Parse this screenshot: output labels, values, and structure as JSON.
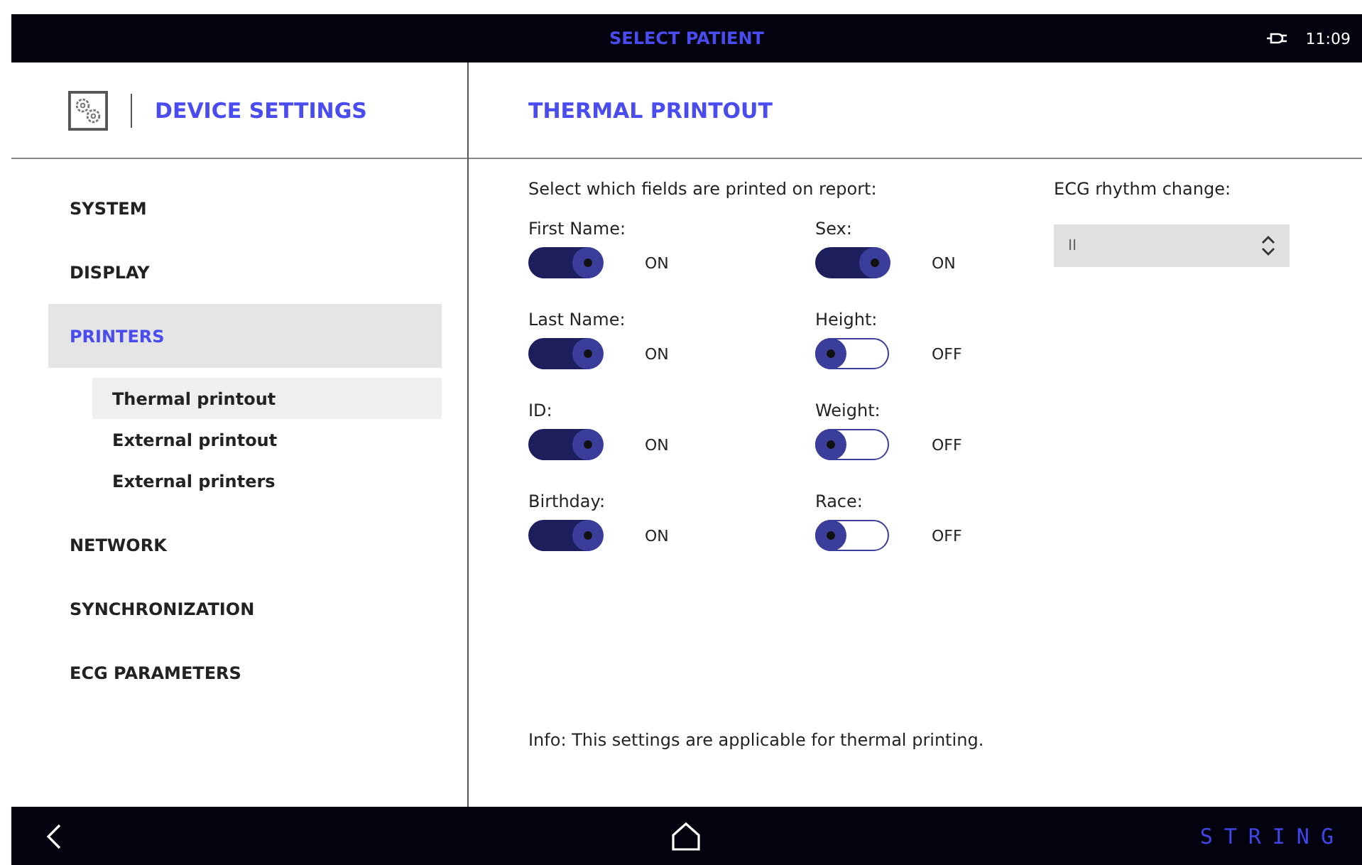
{
  "top_bar": {
    "title": "SELECT PATIENT",
    "time": "11:09"
  },
  "sidebar": {
    "title": "DEVICE SETTINGS",
    "items": [
      {
        "label": "SYSTEM",
        "selected": false
      },
      {
        "label": "DISPLAY",
        "selected": false
      },
      {
        "label": "PRINTERS",
        "selected": true,
        "children": [
          {
            "label": "Thermal printout",
            "selected": true
          },
          {
            "label": "External printout",
            "selected": false
          },
          {
            "label": "External printers",
            "selected": false
          }
        ]
      },
      {
        "label": "NETWORK",
        "selected": false
      },
      {
        "label": "SYNCHRONIZATION",
        "selected": false
      },
      {
        "label": "ECG PARAMETERS",
        "selected": false
      }
    ]
  },
  "content": {
    "title": "THERMAL PRINTOUT",
    "intro": "Select which fields are printed on report:",
    "toggles": [
      {
        "label": "First Name:",
        "on": true,
        "state": "ON"
      },
      {
        "label": "Last Name:",
        "on": true,
        "state": "ON"
      },
      {
        "label": "ID:",
        "on": true,
        "state": "ON"
      },
      {
        "label": "Birthday:",
        "on": true,
        "state": "ON"
      },
      {
        "label": "Sex:",
        "on": true,
        "state": "ON"
      },
      {
        "label": "Height:",
        "on": false,
        "state": "OFF"
      },
      {
        "label": "Weight:",
        "on": false,
        "state": "OFF"
      },
      {
        "label": "Race:",
        "on": false,
        "state": "OFF"
      }
    ],
    "rhythm": {
      "label": "ECG rhythm change:",
      "value": "II"
    },
    "info": "Info: This settings are applicable for thermal printing."
  },
  "bottom_bar": {
    "brand": "STRING"
  }
}
